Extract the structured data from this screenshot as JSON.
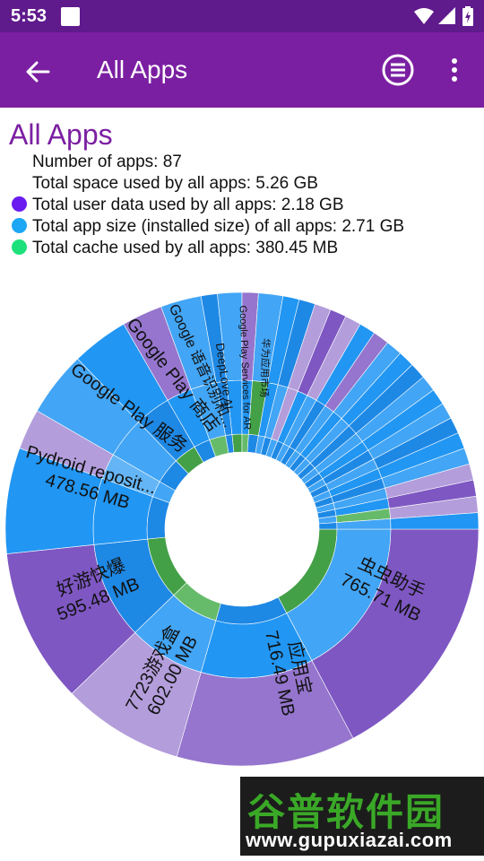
{
  "status_bar": {
    "time": "5:53"
  },
  "app_bar": {
    "title": "All Apps"
  },
  "summary": {
    "heading": "All Apps",
    "num_apps": "Number of apps: 87",
    "total_space": "Total space used by all apps: 5.26 GB",
    "user_data": "Total user data used by all apps: 2.18 GB",
    "app_size": "Total app size (installed size) of all apps: 2.71 GB",
    "cache": "Total cache used by all apps: 380.45 MB"
  },
  "legend_colors": {
    "user_data": "#6a1bf0",
    "app_size": "#1ea7f5",
    "cache": "#1ee07a"
  },
  "colors": {
    "status_bar": "#5f1a8c",
    "app_bar": "#7b1fa2",
    "heading": "#7b1fa2"
  },
  "chart_labels": {
    "chongchong": [
      "虫虫助手",
      "765.71 MB"
    ],
    "yingyongbao": [
      "应用宝",
      "716.49 MB"
    ],
    "box7723": [
      "7723游戏盒",
      "602.00 MB"
    ],
    "haoyou": [
      "好游快爆",
      "595.48 MB"
    ],
    "pydroid": [
      "Pydroid reposit...",
      "478.56 MB"
    ],
    "gps": [
      "Google Play 服务"
    ],
    "gpstore": [
      "Google Play 商店"
    ],
    "gvoice": [
      "Google 语音识别和..."
    ],
    "deeplove": [
      "DeepLove AI"
    ],
    "arcore": [
      "Google Play Services for AR"
    ],
    "huawei": [
      "华为应用市场"
    ]
  },
  "watermark": {
    "cn": "谷普软件园",
    "url": "www.gupuxiazai.com"
  }
}
